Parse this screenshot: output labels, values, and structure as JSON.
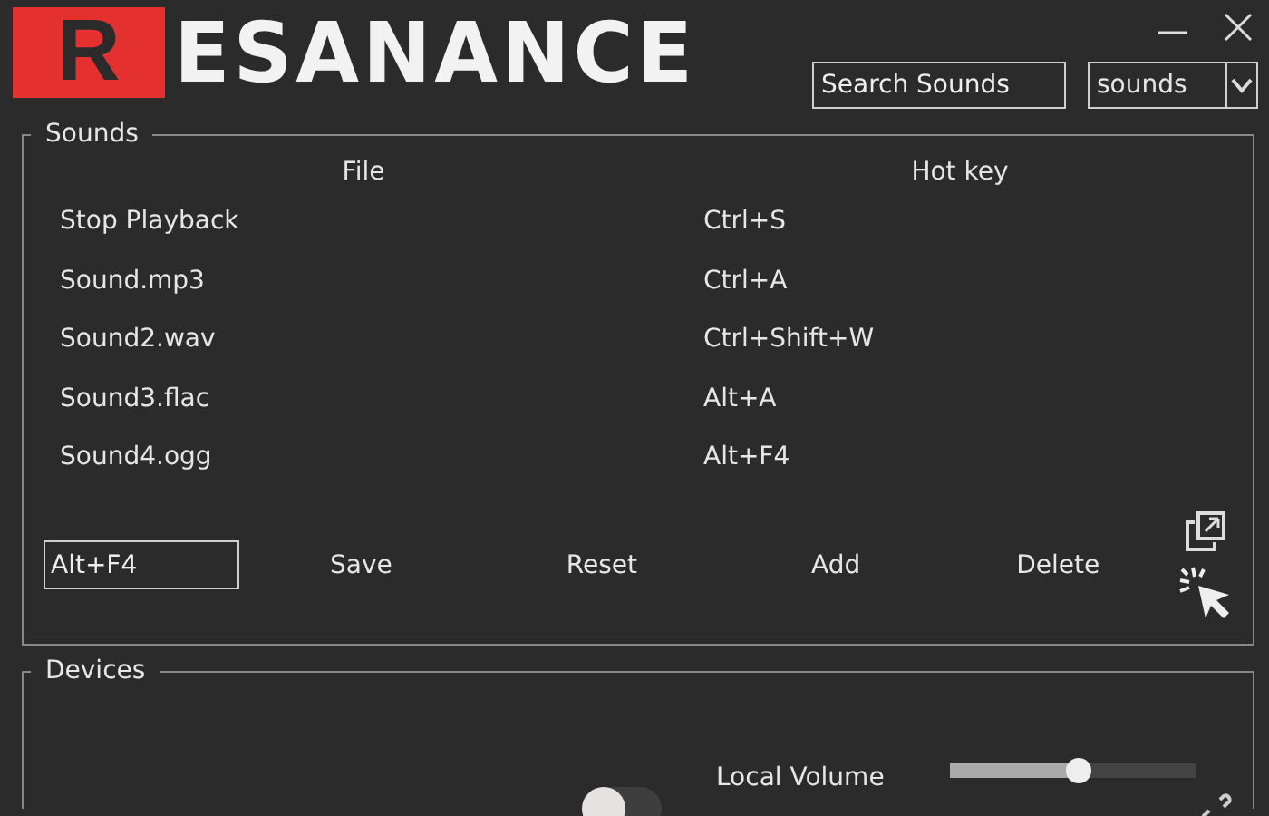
{
  "logo": {
    "initial": "R",
    "rest": "ESANANCE"
  },
  "search": {
    "placeholder": "Search Sounds"
  },
  "filter": {
    "value": "sounds"
  },
  "sounds": {
    "title": "Sounds",
    "columns": [
      "File",
      "Hot key"
    ],
    "rows": [
      {
        "file": "Stop Playback",
        "hotkey": "Ctrl+S"
      },
      {
        "file": "Sound.mp3",
        "hotkey": "Ctrl+A"
      },
      {
        "file": "Sound2.wav",
        "hotkey": "Ctrl+Shift+W"
      },
      {
        "file": "Sound3.flac",
        "hotkey": "Alt+A"
      },
      {
        "file": "Sound4.ogg",
        "hotkey": "Alt+F4"
      }
    ],
    "hotkey_field": {
      "value": "Alt+F4"
    },
    "buttons": [
      "Save",
      "Reset",
      "Add",
      "Delete"
    ]
  },
  "devices": {
    "title": "Devices",
    "toggle": {
      "on": false
    },
    "volume": {
      "label": "Local Volume",
      "level": 0.52
    }
  }
}
